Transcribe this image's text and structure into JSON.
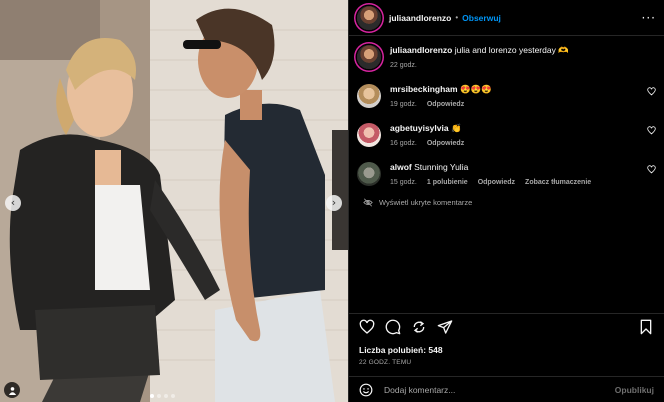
{
  "header": {
    "username": "juliaandlorenzo",
    "separator": "•",
    "follow_label": "Obserwuj",
    "more_icon": "more-horizontal-icon"
  },
  "caption": {
    "username": "juliaandlorenzo",
    "text": "julia and lorenzo yesterday 🫶",
    "time": "22 godz."
  },
  "comments": [
    {
      "username": "mrsibeckingham",
      "text": "😍😍😍",
      "time": "19 godz.",
      "reply": "Odpowiedz"
    },
    {
      "username": "agbetuyisylvia",
      "text": "👏",
      "time": "16 godz.",
      "reply": "Odpowiedz"
    },
    {
      "username": "alwof",
      "text": "Stunning Yulia",
      "time": "15 godz.",
      "likes": "1 polubienie",
      "reply": "Odpowiedz",
      "translate": "Zobacz tłumaczenie"
    }
  ],
  "hidden_comments_label": "Wyświetl ukryte komentarze",
  "likes_label": "Liczba polubień: 548",
  "post_time": "22 GODZ. TEMU",
  "composer": {
    "placeholder": "Dodaj komentarz...",
    "post_label": "Opublikuj"
  },
  "media": {
    "slide_count": 4,
    "active_slide": 1,
    "prev_icon": "chevron-left-icon",
    "next_icon": "chevron-right-icon"
  },
  "colors": {
    "accent": "#0095f6",
    "background": "#000000",
    "secondary_text": "#a8a8a8"
  }
}
